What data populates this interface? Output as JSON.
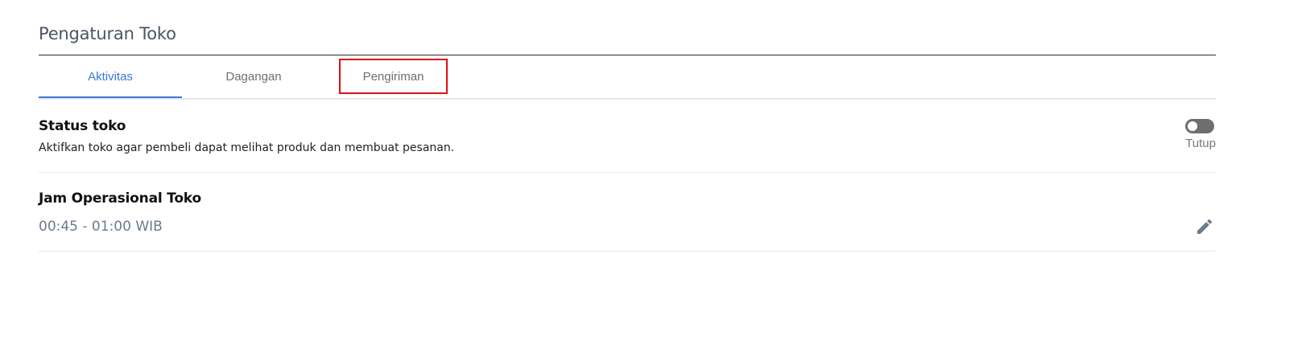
{
  "page": {
    "title": "Pengaturan Toko"
  },
  "tabs": [
    {
      "label": "Aktivitas",
      "active": true
    },
    {
      "label": "Dagangan",
      "active": false
    },
    {
      "label": "Pengiriman",
      "active": false,
      "highlighted": true
    }
  ],
  "store_status": {
    "heading": "Status toko",
    "description": "Aktifkan toko agar pembeli dapat melihat produk dan membuat pesanan.",
    "toggle_on": false,
    "toggle_label": "Tutup"
  },
  "operating_hours": {
    "heading": "Jam Operasional Toko",
    "value": "00:45 - 01:00 WIB",
    "edit_icon": "pencil-icon"
  },
  "colors": {
    "accent": "#3d78d8",
    "highlight_border": "#e01010",
    "toggle_off": "#6e6e6e",
    "muted_text": "#6b7a8f"
  }
}
